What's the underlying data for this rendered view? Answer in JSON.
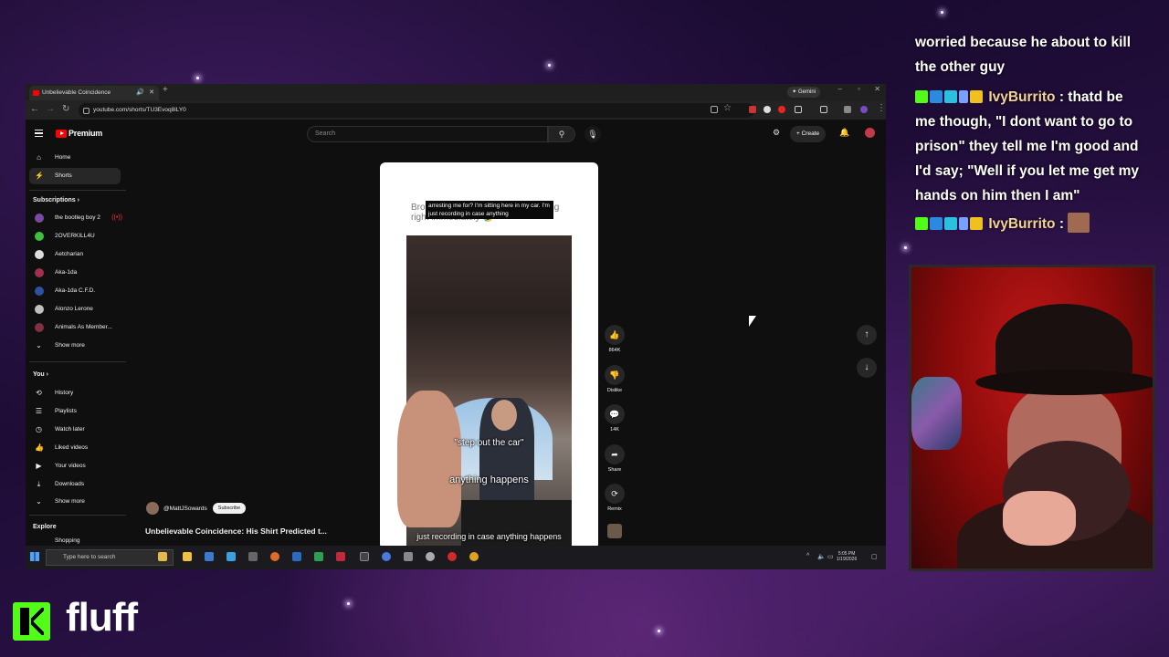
{
  "browser": {
    "tab_title": "Unbelievable Coincidence",
    "url": "youtube.com/shorts/TU3Evoq8iLY0",
    "gemini_label": "Gemini"
  },
  "youtube": {
    "brand": "Premium",
    "search_placeholder": "Search",
    "create_label": "Create",
    "sidebar": {
      "home": "Home",
      "shorts": "Shorts",
      "subscriptions_header": "Subscriptions",
      "channels": [
        {
          "name": "the bootleg boy 2",
          "color": "#7a4aa0",
          "live": true
        },
        {
          "name": "2OVERKILL4U",
          "color": "#3fbf3f",
          "live": false
        },
        {
          "name": "Aetcharian",
          "color": "#dddddd",
          "live": false
        },
        {
          "name": "Aka-1da",
          "color": "#a03050",
          "live": false
        },
        {
          "name": "Aka-1da C.F.D.",
          "color": "#3050a0",
          "live": false
        },
        {
          "name": "Alonzo Lerone",
          "color": "#c0c0c0",
          "live": false
        },
        {
          "name": "Animals As Member...",
          "color": "#803040",
          "live": false
        }
      ],
      "show_more": "Show more",
      "you_header": "You",
      "you_items": [
        "History",
        "Playlists",
        "Watch later",
        "Liked videos",
        "Your videos",
        "Downloads"
      ],
      "show_more_2": "Show more",
      "explore_header": "Explore",
      "explore_partial": "Shopping"
    },
    "short": {
      "caption_grey": "Bro got sent to jail and started acting right immediately 🤣",
      "caption_box": "arresting me for? I'm sitting here in my car. I'm just recording in case anything",
      "subtitle_1": "\"step out the car\"",
      "subtitle_2": "anything happens",
      "subtitle_3": "just recording in case anything happens",
      "progress": 0.18
    },
    "actions": {
      "likes": "864K",
      "dislike": "Dislike",
      "comments": "14K",
      "share": "Share",
      "remix": "Remix"
    },
    "channel": {
      "handle": "@MattJSowards",
      "subscribe": "Subscribe"
    },
    "video_title": "Unbelievable Coincidence: His Shirt Predicted t..."
  },
  "taskbar": {
    "search_placeholder": "Type here to search",
    "time": "5:05 PM",
    "date": "1/19/2026"
  },
  "chat": {
    "line1": "worried because he about to kill",
    "line2": "the other guy",
    "user": "IvyBurrito",
    "msg1_start": " : thatd be",
    "msg1_l2": "me though, \"I dont want to go to",
    "msg1_l3": "prison\" they tell me I'm good and",
    "msg1_l4": "I'd say; \"Well if you let me get my",
    "msg1_l5": "hands on him then I am\"",
    "user2": "IvyBurrito",
    "msg2": " :"
  },
  "brand": {
    "name": "fluff",
    "accent": "#53fc18"
  }
}
